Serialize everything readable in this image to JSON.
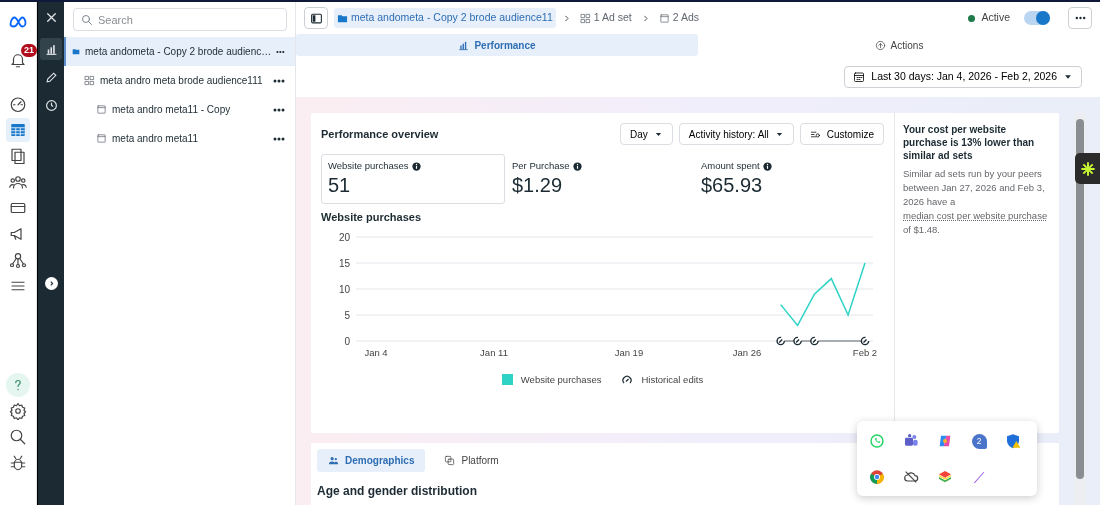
{
  "rail": {
    "items": [
      {
        "kind": "meta",
        "selected": false
      },
      {
        "kind": "bell",
        "selected": false,
        "badge": "21"
      },
      {
        "kind": "gauge",
        "selected": false
      },
      {
        "kind": "table",
        "selected": true
      },
      {
        "kind": "pages",
        "selected": false
      },
      {
        "kind": "people",
        "selected": false
      },
      {
        "kind": "card",
        "selected": false
      },
      {
        "kind": "megaphone",
        "selected": false
      },
      {
        "kind": "network",
        "selected": false
      },
      {
        "kind": "menu",
        "selected": false
      }
    ],
    "bottom_items": [
      {
        "kind": "help",
        "selected": true
      },
      {
        "kind": "settings",
        "selected": false
      },
      {
        "kind": "search",
        "selected": false
      },
      {
        "kind": "bug",
        "selected": false
      }
    ]
  },
  "strip": {
    "items": [
      {
        "kind": "close",
        "selected": false
      },
      {
        "kind": "chart",
        "selected": true
      },
      {
        "kind": "pencil",
        "selected": false
      },
      {
        "kind": "clock",
        "selected": false
      }
    ]
  },
  "tree": {
    "search": {
      "placeholder": "Search"
    },
    "items": [
      {
        "kind": "campaign",
        "label": "meta andometa - Copy 2 brode audienc…",
        "selected": true,
        "children": [
          {
            "kind": "adset",
            "label": "meta andro meta brode audience111",
            "selected": false,
            "children": [
              {
                "kind": "ad",
                "label": "meta andro meta11 - Copy",
                "selected": false
              },
              {
                "kind": "ad",
                "label": "meta andro meta11",
                "selected": false
              }
            ]
          }
        ]
      }
    ]
  },
  "header": {
    "breadcrumbs": [
      {
        "kind": "campaign",
        "label": "meta andometa - Copy 2 brode audience11",
        "selected": true
      },
      {
        "kind": "adset",
        "label": "1 Ad set",
        "selected": false
      },
      {
        "kind": "ad",
        "label": "2 Ads",
        "selected": false
      }
    ],
    "status": "Active",
    "toggle_on": true
  },
  "tabs": [
    {
      "kind": "performance",
      "label": "Performance",
      "selected": true
    },
    {
      "kind": "actions",
      "label": "Actions",
      "selected": false
    }
  ],
  "date_range": "Last 30 days: Jan 4, 2026 - Feb 2, 2026",
  "overview": {
    "title": "Performance overview",
    "controls": [
      {
        "kind": "dropdown",
        "label": "Day"
      },
      {
        "kind": "dropdown",
        "label": "Activity history: All"
      },
      {
        "kind": "customize",
        "label": "Customize"
      }
    ],
    "metrics": [
      {
        "label": "Website purchases",
        "value": "51",
        "selected": true
      },
      {
        "label": "Per Purchase",
        "value": "$1.29",
        "selected": false
      },
      {
        "label": "Amount spent",
        "value": "$65.93",
        "selected": false
      }
    ],
    "chart_title": "Website purchases",
    "chart_data": {
      "type": "line",
      "categories": [
        "Jan 4",
        null,
        null,
        null,
        null,
        null,
        null,
        "Jan 11",
        null,
        null,
        null,
        null,
        null,
        null,
        null,
        "Jan 19",
        null,
        null,
        null,
        null,
        null,
        null,
        "Jan 26",
        null,
        null,
        null,
        null,
        null,
        null,
        "Feb 2"
      ],
      "series": [
        {
          "name": "Website purchases",
          "color": "#2ed3c6",
          "values": [
            null,
            null,
            null,
            null,
            null,
            null,
            null,
            null,
            null,
            null,
            null,
            null,
            null,
            null,
            null,
            null,
            null,
            null,
            null,
            null,
            null,
            null,
            null,
            null,
            7,
            3,
            9,
            12,
            5,
            15
          ]
        },
        {
          "name": "Historical edits",
          "color": "#1c2b33",
          "marker": true,
          "values": [
            null,
            null,
            null,
            null,
            null,
            null,
            null,
            null,
            null,
            null,
            null,
            null,
            null,
            null,
            null,
            null,
            null,
            null,
            null,
            null,
            null,
            null,
            null,
            null,
            0,
            0,
            0,
            null,
            null,
            0
          ]
        }
      ],
      "ylim": [
        0,
        20
      ],
      "yticks": [
        0,
        5,
        10,
        15,
        20
      ],
      "grid": true
    }
  },
  "insight": {
    "title": "Your cost per website purchase is 13% lower than similar ad sets",
    "body_before": "Similar ad sets run by your peers between Jan 27, 2026 and Feb 3, 2026 have a ",
    "link": "median cost per website purchase",
    "body_after": " of $1.48."
  },
  "breakdown": {
    "tabs": [
      {
        "kind": "demographics",
        "label": "Demographics",
        "selected": true
      },
      {
        "kind": "platform",
        "label": "Platform",
        "selected": false
      }
    ],
    "title": "Age and gender distribution"
  },
  "tray": {
    "items": [
      {
        "kind": "whatsapp"
      },
      {
        "kind": "teams"
      },
      {
        "kind": "copilot"
      },
      {
        "kind": "chat",
        "badge": "2"
      },
      {
        "kind": "shield"
      },
      {
        "kind": "chrome"
      },
      {
        "kind": "cloud-off"
      },
      {
        "kind": "layers"
      },
      {
        "kind": "pen"
      }
    ]
  }
}
